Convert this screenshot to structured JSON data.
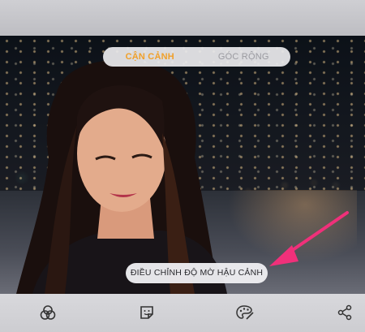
{
  "mode_selector": {
    "options": [
      "CẬN CẢNH",
      "GÓC RỘNG"
    ],
    "selected_index": 0
  },
  "blur_button": {
    "label": "ĐIỀU CHỈNH ĐỘ MỜ HẬU CẢNH"
  },
  "toolbar": {
    "icons": [
      "effects-icon",
      "sticker-icon",
      "paint-palette-icon",
      "share-icon"
    ]
  },
  "accent_colors": {
    "active_mode": "#f0a02a",
    "annotation_arrow": "#f0307a"
  }
}
